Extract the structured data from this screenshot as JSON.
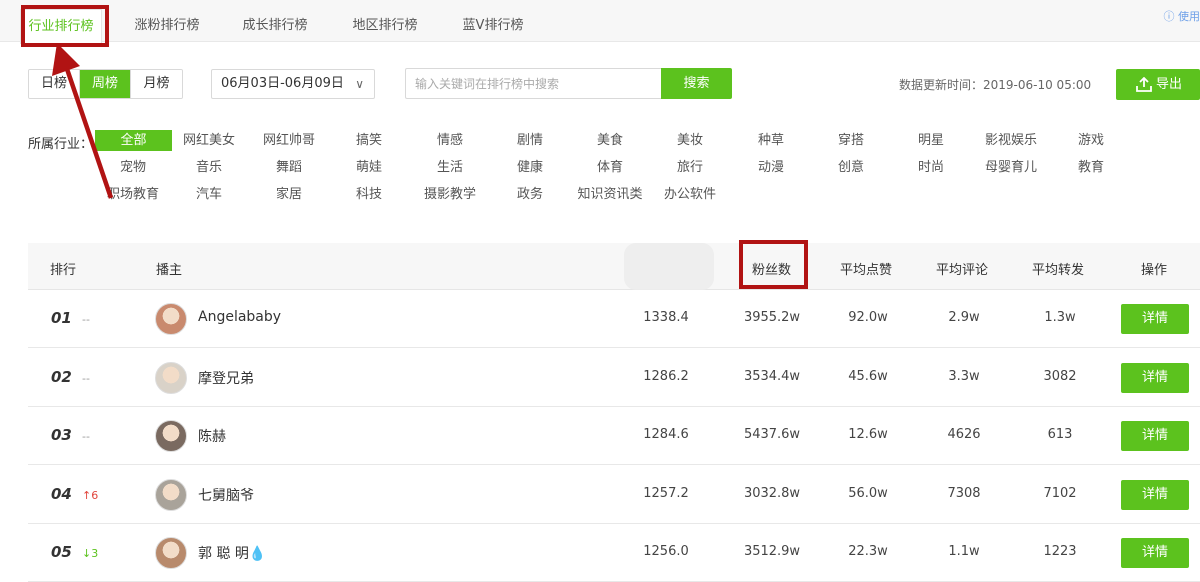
{
  "tabs": [
    "行业排行榜",
    "涨粉排行榜",
    "成长排行榜",
    "地区排行榜",
    "蓝V排行榜"
  ],
  "help_label": "使用",
  "period": [
    "日榜",
    "周榜",
    "月榜"
  ],
  "date_range": "06月03日-06月09日",
  "search": {
    "placeholder": "输入关键词在排行榜中搜索",
    "button": "搜索"
  },
  "update_time": "数据更新时间：2019-06-10 05:00",
  "export_label": "导出",
  "industry_label": "所属行业：",
  "industries": [
    "全部",
    "网红美女",
    "网红帅哥",
    "搞笑",
    "情感",
    "剧情",
    "美食",
    "美妆",
    "种草",
    "穿搭",
    "明星",
    "影视娱乐",
    "游戏",
    "宠物",
    "音乐",
    "舞蹈",
    "萌娃",
    "生活",
    "健康",
    "体育",
    "旅行",
    "动漫",
    "创意",
    "时尚",
    "母婴育儿",
    "教育",
    "职场教育",
    "汽车",
    "家居",
    "科技",
    "摄影教学",
    "政务",
    "知识资讯类",
    "办公软件"
  ],
  "table": {
    "headers": [
      "排行",
      "播主",
      "粉丝数",
      "平均点赞",
      "平均评论",
      "平均转发",
      "操作"
    ],
    "rows": [
      {
        "rank": "01",
        "trend": "--",
        "name": "Angelababy",
        "score": "1338.4",
        "fans": "3955.2w",
        "likes": "92.0w",
        "comments": "2.9w",
        "shares": "1.3w",
        "action": "详情"
      },
      {
        "rank": "02",
        "trend": "--",
        "name": "摩登兄弟",
        "score": "1286.2",
        "fans": "3534.4w",
        "likes": "45.6w",
        "comments": "3.3w",
        "shares": "3082",
        "action": "详情"
      },
      {
        "rank": "03",
        "trend": "--",
        "name": "陈赫",
        "score": "1284.6",
        "fans": "5437.6w",
        "likes": "12.6w",
        "comments": "4626",
        "shares": "613",
        "action": "详情"
      },
      {
        "rank": "04",
        "trend": "↑6",
        "name": "七舅脑爷",
        "score": "1257.2",
        "fans": "3032.8w",
        "likes": "56.0w",
        "comments": "7308",
        "shares": "7102",
        "action": "详情"
      },
      {
        "rank": "05",
        "trend": "↓3",
        "name": "郭 聪 明💧",
        "score": "1256.0",
        "fans": "3512.9w",
        "likes": "22.3w",
        "comments": "1.1w",
        "shares": "1223",
        "action": "详情"
      }
    ]
  },
  "colors": {
    "accent": "#5cc21e",
    "annotation": "#b11313",
    "up": "#e0453c",
    "down": "#5cc21e"
  }
}
